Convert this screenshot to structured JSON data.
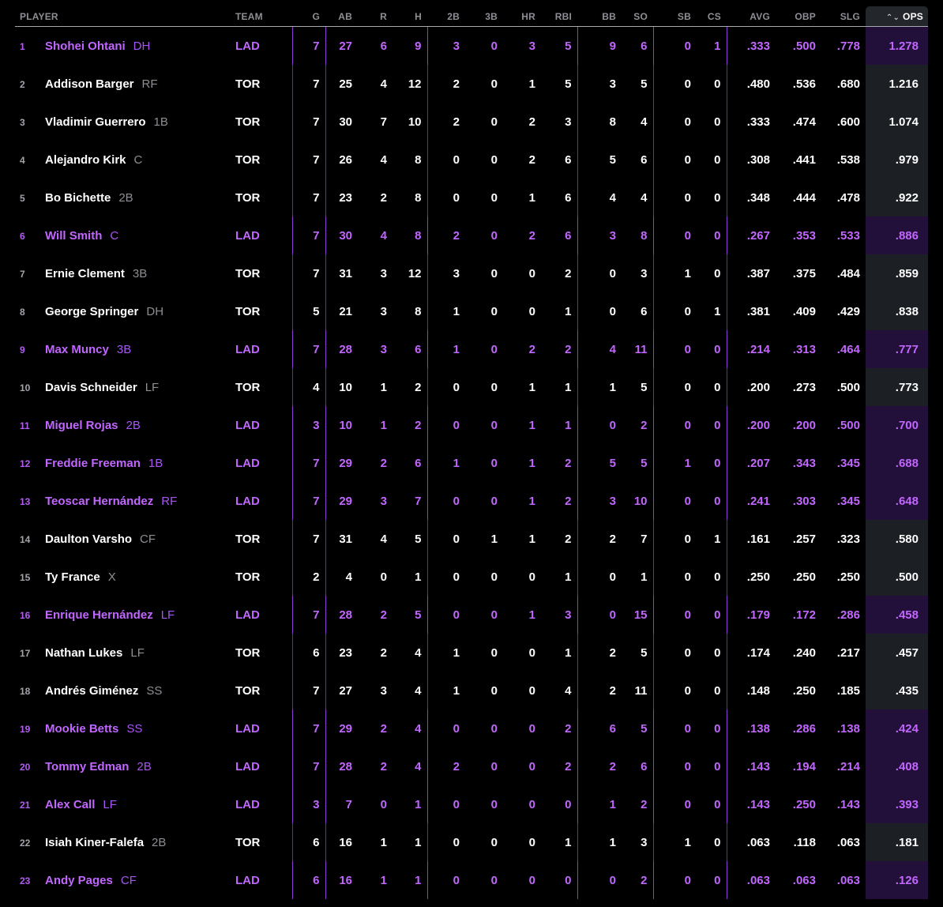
{
  "headers": {
    "player": "PLAYER",
    "team": "TEAM",
    "g": "G",
    "ab": "AB",
    "r": "R",
    "h": "H",
    "doubles": "2B",
    "triples": "3B",
    "hr": "HR",
    "rbi": "RBI",
    "bb": "BB",
    "so": "SO",
    "sb": "SB",
    "cs": "CS",
    "avg": "AVG",
    "obp": "OBP",
    "slg": "SLG",
    "ops": "OPS"
  },
  "sort": {
    "column": "OPS",
    "icon": "sort-chevrons-icon"
  },
  "colors": {
    "background": "#000000",
    "tor_text": "#ffffff",
    "lad_text": "#c266ff",
    "header_text": "#8e8e95",
    "ops_column_bg": "#1c1f23",
    "ops_column_lad_bg": "#220f3a"
  },
  "rows": [
    {
      "rank": "1",
      "name": "Shohei Ohtani",
      "pos": "DH",
      "team": "LAD",
      "g": "7",
      "ab": "27",
      "r": "6",
      "h": "9",
      "doubles": "3",
      "triples": "0",
      "hr": "3",
      "rbi": "5",
      "bb": "9",
      "so": "6",
      "sb": "0",
      "cs": "1",
      "avg": ".333",
      "obp": ".500",
      "slg": ".778",
      "ops": "1.278"
    },
    {
      "rank": "2",
      "name": "Addison Barger",
      "pos": "RF",
      "team": "TOR",
      "g": "7",
      "ab": "25",
      "r": "4",
      "h": "12",
      "doubles": "2",
      "triples": "0",
      "hr": "1",
      "rbi": "5",
      "bb": "3",
      "so": "5",
      "sb": "0",
      "cs": "0",
      "avg": ".480",
      "obp": ".536",
      "slg": ".680",
      "ops": "1.216"
    },
    {
      "rank": "3",
      "name": "Vladimir Guerrero",
      "pos": "1B",
      "team": "TOR",
      "g": "7",
      "ab": "30",
      "r": "7",
      "h": "10",
      "doubles": "2",
      "triples": "0",
      "hr": "2",
      "rbi": "3",
      "bb": "8",
      "so": "4",
      "sb": "0",
      "cs": "0",
      "avg": ".333",
      "obp": ".474",
      "slg": ".600",
      "ops": "1.074"
    },
    {
      "rank": "4",
      "name": "Alejandro Kirk",
      "pos": "C",
      "team": "TOR",
      "g": "7",
      "ab": "26",
      "r": "4",
      "h": "8",
      "doubles": "0",
      "triples": "0",
      "hr": "2",
      "rbi": "6",
      "bb": "5",
      "so": "6",
      "sb": "0",
      "cs": "0",
      "avg": ".308",
      "obp": ".441",
      "slg": ".538",
      "ops": ".979"
    },
    {
      "rank": "5",
      "name": "Bo Bichette",
      "pos": "2B",
      "team": "TOR",
      "g": "7",
      "ab": "23",
      "r": "2",
      "h": "8",
      "doubles": "0",
      "triples": "0",
      "hr": "1",
      "rbi": "6",
      "bb": "4",
      "so": "4",
      "sb": "0",
      "cs": "0",
      "avg": ".348",
      "obp": ".444",
      "slg": ".478",
      "ops": ".922"
    },
    {
      "rank": "6",
      "name": "Will Smith",
      "pos": "C",
      "team": "LAD",
      "g": "7",
      "ab": "30",
      "r": "4",
      "h": "8",
      "doubles": "2",
      "triples": "0",
      "hr": "2",
      "rbi": "6",
      "bb": "3",
      "so": "8",
      "sb": "0",
      "cs": "0",
      "avg": ".267",
      "obp": ".353",
      "slg": ".533",
      "ops": ".886"
    },
    {
      "rank": "7",
      "name": "Ernie Clement",
      "pos": "3B",
      "team": "TOR",
      "g": "7",
      "ab": "31",
      "r": "3",
      "h": "12",
      "doubles": "3",
      "triples": "0",
      "hr": "0",
      "rbi": "2",
      "bb": "0",
      "so": "3",
      "sb": "1",
      "cs": "0",
      "avg": ".387",
      "obp": ".375",
      "slg": ".484",
      "ops": ".859"
    },
    {
      "rank": "8",
      "name": "George Springer",
      "pos": "DH",
      "team": "TOR",
      "g": "5",
      "ab": "21",
      "r": "3",
      "h": "8",
      "doubles": "1",
      "triples": "0",
      "hr": "0",
      "rbi": "1",
      "bb": "0",
      "so": "6",
      "sb": "0",
      "cs": "1",
      "avg": ".381",
      "obp": ".409",
      "slg": ".429",
      "ops": ".838"
    },
    {
      "rank": "9",
      "name": "Max Muncy",
      "pos": "3B",
      "team": "LAD",
      "g": "7",
      "ab": "28",
      "r": "3",
      "h": "6",
      "doubles": "1",
      "triples": "0",
      "hr": "2",
      "rbi": "2",
      "bb": "4",
      "so": "11",
      "sb": "0",
      "cs": "0",
      "avg": ".214",
      "obp": ".313",
      "slg": ".464",
      "ops": ".777"
    },
    {
      "rank": "10",
      "name": "Davis Schneider",
      "pos": "LF",
      "team": "TOR",
      "g": "4",
      "ab": "10",
      "r": "1",
      "h": "2",
      "doubles": "0",
      "triples": "0",
      "hr": "1",
      "rbi": "1",
      "bb": "1",
      "so": "5",
      "sb": "0",
      "cs": "0",
      "avg": ".200",
      "obp": ".273",
      "slg": ".500",
      "ops": ".773"
    },
    {
      "rank": "11",
      "name": "Miguel Rojas",
      "pos": "2B",
      "team": "LAD",
      "g": "3",
      "ab": "10",
      "r": "1",
      "h": "2",
      "doubles": "0",
      "triples": "0",
      "hr": "1",
      "rbi": "1",
      "bb": "0",
      "so": "2",
      "sb": "0",
      "cs": "0",
      "avg": ".200",
      "obp": ".200",
      "slg": ".500",
      "ops": ".700"
    },
    {
      "rank": "12",
      "name": "Freddie Freeman",
      "pos": "1B",
      "team": "LAD",
      "g": "7",
      "ab": "29",
      "r": "2",
      "h": "6",
      "doubles": "1",
      "triples": "0",
      "hr": "1",
      "rbi": "2",
      "bb": "5",
      "so": "5",
      "sb": "1",
      "cs": "0",
      "avg": ".207",
      "obp": ".343",
      "slg": ".345",
      "ops": ".688"
    },
    {
      "rank": "13",
      "name": "Teoscar Hernández",
      "pos": "RF",
      "team": "LAD",
      "g": "7",
      "ab": "29",
      "r": "3",
      "h": "7",
      "doubles": "0",
      "triples": "0",
      "hr": "1",
      "rbi": "2",
      "bb": "3",
      "so": "10",
      "sb": "0",
      "cs": "0",
      "avg": ".241",
      "obp": ".303",
      "slg": ".345",
      "ops": ".648"
    },
    {
      "rank": "14",
      "name": "Daulton Varsho",
      "pos": "CF",
      "team": "TOR",
      "g": "7",
      "ab": "31",
      "r": "4",
      "h": "5",
      "doubles": "0",
      "triples": "1",
      "hr": "1",
      "rbi": "2",
      "bb": "2",
      "so": "7",
      "sb": "0",
      "cs": "1",
      "avg": ".161",
      "obp": ".257",
      "slg": ".323",
      "ops": ".580"
    },
    {
      "rank": "15",
      "name": "Ty France",
      "pos": "X",
      "team": "TOR",
      "g": "2",
      "ab": "4",
      "r": "0",
      "h": "1",
      "doubles": "0",
      "triples": "0",
      "hr": "0",
      "rbi": "1",
      "bb": "0",
      "so": "1",
      "sb": "0",
      "cs": "0",
      "avg": ".250",
      "obp": ".250",
      "slg": ".250",
      "ops": ".500"
    },
    {
      "rank": "16",
      "name": "Enrique Hernández",
      "pos": "LF",
      "team": "LAD",
      "g": "7",
      "ab": "28",
      "r": "2",
      "h": "5",
      "doubles": "0",
      "triples": "0",
      "hr": "1",
      "rbi": "3",
      "bb": "0",
      "so": "15",
      "sb": "0",
      "cs": "0",
      "avg": ".179",
      "obp": ".172",
      "slg": ".286",
      "ops": ".458"
    },
    {
      "rank": "17",
      "name": "Nathan Lukes",
      "pos": "LF",
      "team": "TOR",
      "g": "6",
      "ab": "23",
      "r": "2",
      "h": "4",
      "doubles": "1",
      "triples": "0",
      "hr": "0",
      "rbi": "1",
      "bb": "2",
      "so": "5",
      "sb": "0",
      "cs": "0",
      "avg": ".174",
      "obp": ".240",
      "slg": ".217",
      "ops": ".457"
    },
    {
      "rank": "18",
      "name": "Andrés Giménez",
      "pos": "SS",
      "team": "TOR",
      "g": "7",
      "ab": "27",
      "r": "3",
      "h": "4",
      "doubles": "1",
      "triples": "0",
      "hr": "0",
      "rbi": "4",
      "bb": "2",
      "so": "11",
      "sb": "0",
      "cs": "0",
      "avg": ".148",
      "obp": ".250",
      "slg": ".185",
      "ops": ".435"
    },
    {
      "rank": "19",
      "name": "Mookie Betts",
      "pos": "SS",
      "team": "LAD",
      "g": "7",
      "ab": "29",
      "r": "2",
      "h": "4",
      "doubles": "0",
      "triples": "0",
      "hr": "0",
      "rbi": "2",
      "bb": "6",
      "so": "5",
      "sb": "0",
      "cs": "0",
      "avg": ".138",
      "obp": ".286",
      "slg": ".138",
      "ops": ".424"
    },
    {
      "rank": "20",
      "name": "Tommy Edman",
      "pos": "2B",
      "team": "LAD",
      "g": "7",
      "ab": "28",
      "r": "2",
      "h": "4",
      "doubles": "2",
      "triples": "0",
      "hr": "0",
      "rbi": "2",
      "bb": "2",
      "so": "6",
      "sb": "0",
      "cs": "0",
      "avg": ".143",
      "obp": ".194",
      "slg": ".214",
      "ops": ".408"
    },
    {
      "rank": "21",
      "name": "Alex Call",
      "pos": "LF",
      "team": "LAD",
      "g": "3",
      "ab": "7",
      "r": "0",
      "h": "1",
      "doubles": "0",
      "triples": "0",
      "hr": "0",
      "rbi": "0",
      "bb": "1",
      "so": "2",
      "sb": "0",
      "cs": "0",
      "avg": ".143",
      "obp": ".250",
      "slg": ".143",
      "ops": ".393"
    },
    {
      "rank": "22",
      "name": "Isiah Kiner-Falefa",
      "pos": "2B",
      "team": "TOR",
      "g": "6",
      "ab": "16",
      "r": "1",
      "h": "1",
      "doubles": "0",
      "triples": "0",
      "hr": "0",
      "rbi": "1",
      "bb": "1",
      "so": "3",
      "sb": "1",
      "cs": "0",
      "avg": ".063",
      "obp": ".118",
      "slg": ".063",
      "ops": ".181"
    },
    {
      "rank": "23",
      "name": "Andy Pages",
      "pos": "CF",
      "team": "LAD",
      "g": "6",
      "ab": "16",
      "r": "1",
      "h": "1",
      "doubles": "0",
      "triples": "0",
      "hr": "0",
      "rbi": "0",
      "bb": "0",
      "so": "2",
      "sb": "0",
      "cs": "0",
      "avg": ".063",
      "obp": ".063",
      "slg": ".063",
      "ops": ".126"
    }
  ]
}
